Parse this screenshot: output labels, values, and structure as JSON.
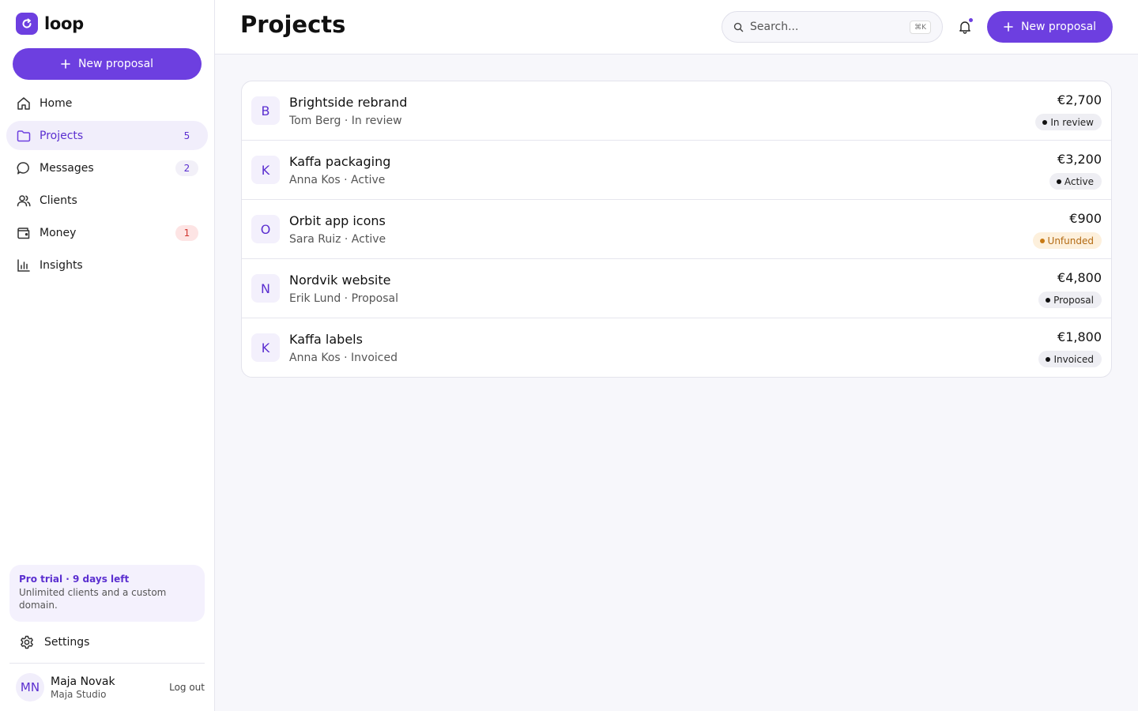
{
  "app": {
    "name": "loop"
  },
  "sidebar": {
    "new_button": "New proposal",
    "items": [
      {
        "label": "Home",
        "icon": "home-icon",
        "badge": ""
      },
      {
        "label": "Projects",
        "icon": "folder-icon",
        "badge": "5"
      },
      {
        "label": "Messages",
        "icon": "chat-icon",
        "badge": "2"
      },
      {
        "label": "Clients",
        "icon": "users-icon",
        "badge": ""
      },
      {
        "label": "Money",
        "icon": "wallet-icon",
        "badge": "1"
      },
      {
        "label": "Insights",
        "icon": "bar-chart-icon",
        "badge": ""
      }
    ],
    "trial": {
      "title": "Pro trial · 9 days left",
      "text": "Unlimited clients and a custom domain."
    },
    "settings_label": "Settings",
    "user": {
      "initials": "MN",
      "name": "Maja Novak",
      "org": "Maja Studio",
      "logout": "Log out"
    }
  },
  "topbar": {
    "title": "Projects",
    "search_placeholder": "Search...",
    "search_shortcut": "⌘K",
    "new_button": "New proposal"
  },
  "projects": [
    {
      "initial": "B",
      "title": "Brightside rebrand",
      "subtitle": "Tom Berg · In review",
      "amount": "€2,700",
      "status": "In review"
    },
    {
      "initial": "K",
      "title": "Kaffa packaging",
      "subtitle": "Anna Kos · Active",
      "amount": "€3,200",
      "status": "Active"
    },
    {
      "initial": "O",
      "title": "Orbit app icons",
      "subtitle": "Sara Ruiz · Active",
      "amount": "€900",
      "status": "Unfunded"
    },
    {
      "initial": "N",
      "title": "Nordvik website",
      "subtitle": "Erik Lund · Proposal",
      "amount": "€4,800",
      "status": "Proposal"
    },
    {
      "initial": "K",
      "title": "Kaffa labels",
      "subtitle": "Anna Kos · Invoiced",
      "amount": "€1,800",
      "status": "Invoiced"
    }
  ],
  "colors": {
    "accent": "#6d3fe0",
    "unfunded": "#c87a13",
    "alert": "#d0352f"
  }
}
